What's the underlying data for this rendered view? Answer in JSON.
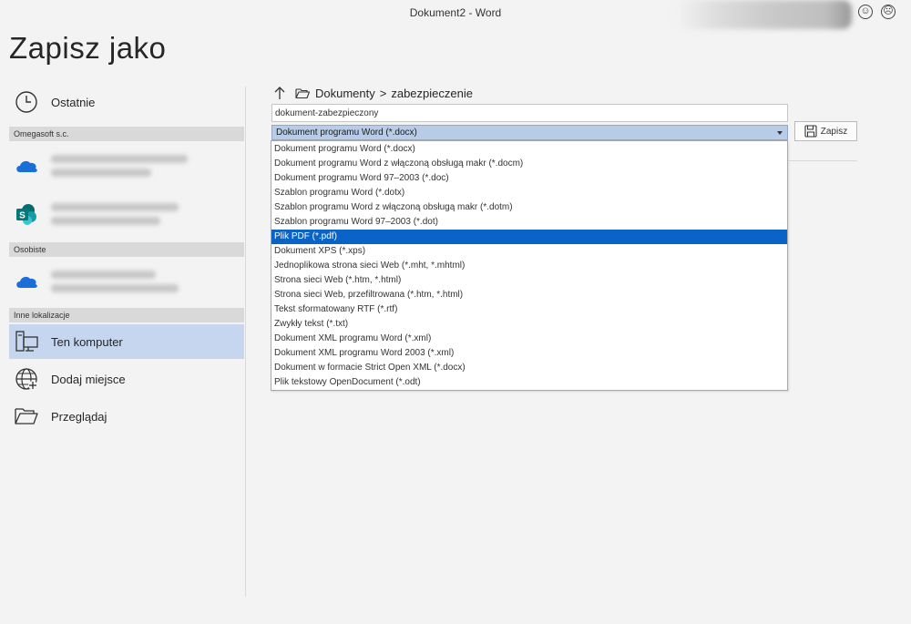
{
  "window": {
    "title": "Dokument2  -  Word"
  },
  "page": {
    "title": "Zapisz jako"
  },
  "nav": {
    "recent_label": "Ostatnie",
    "sections": [
      {
        "label": "Omegasoft   s.c."
      },
      {
        "label": "Osobiste"
      },
      {
        "label": "Inne lokalizacje"
      }
    ],
    "this_pc_label": "Ten komputer",
    "add_place_label": "Dodaj miejsce",
    "browse_label": "Przeglądaj"
  },
  "colors": {
    "selected_nav": "#c5d6ee",
    "highlight": "#0a64c8",
    "onedrive": "#1a6ed8",
    "sharepoint": "#038387"
  },
  "location": {
    "breadcrumb_root": "Dokumenty",
    "breadcrumb_separator": ">",
    "breadcrumb_folder": "zabezpieczenie"
  },
  "filename": {
    "value": "dokument-zabezpieczony"
  },
  "filetype": {
    "selected": "Dokument programu Word (*.docx)",
    "options": [
      "Dokument programu Word (*.docx)",
      "Dokument programu Word z włączoną obsługą makr (*.docm)",
      "Dokument programu Word 97–2003 (*.doc)",
      "Szablon programu Word (*.dotx)",
      "Szablon programu Word z włączoną obsługą makr (*.dotm)",
      "Szablon programu Word 97–2003 (*.dot)",
      "Plik PDF (*.pdf)",
      "Dokument XPS (*.xps)",
      "Jednoplikowa strona sieci Web (*.mht, *.mhtml)",
      "Strona sieci Web (*.htm, *.html)",
      "Strona sieci Web, przefiltrowana (*.htm, *.html)",
      "Tekst sformatowany RTF (*.rtf)",
      "Zwykły tekst (*.txt)",
      "Dokument XML programu Word (*.xml)",
      "Dokument XML programu Word 2003 (*.xml)",
      "Dokument w formacie Strict Open XML (*.docx)",
      "Plik tekstowy OpenDocument (*.odt)"
    ],
    "highlighted_index": 6
  },
  "actions": {
    "save_label": "Zapisz"
  }
}
